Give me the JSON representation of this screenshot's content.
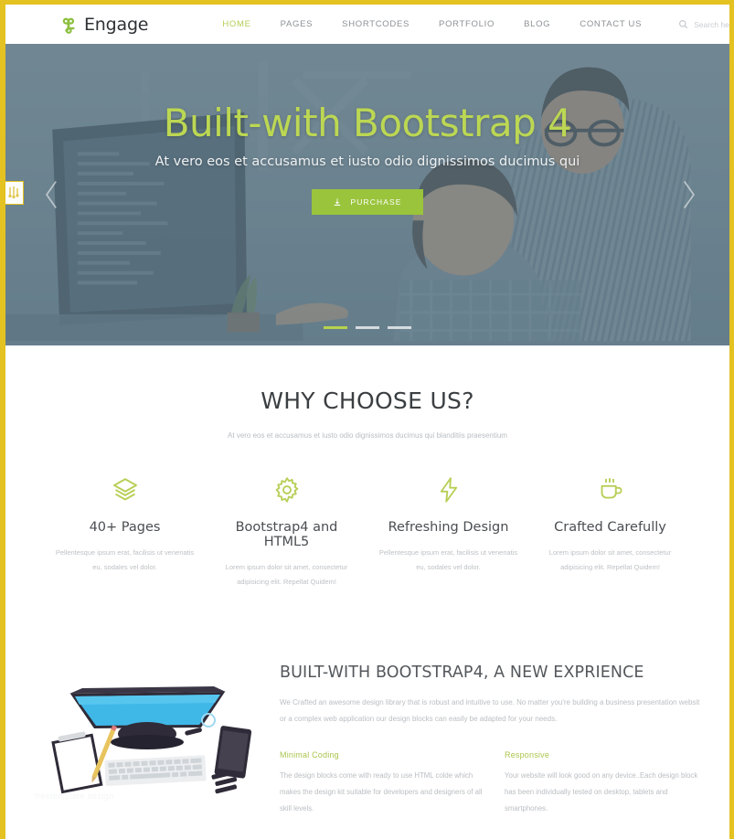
{
  "brand": {
    "name": "Engage",
    "logo_icon": "command-logo-icon",
    "accent_green": "#9ac43c",
    "accent_lime": "#bcd753",
    "border_yellow": "#e3c222"
  },
  "header": {
    "nav": [
      {
        "label": "HOME",
        "active": true
      },
      {
        "label": "PAGES",
        "active": false
      },
      {
        "label": "SHORTCODES",
        "active": false
      },
      {
        "label": "PORTFOLIO",
        "active": false
      },
      {
        "label": "BLOG",
        "active": false
      },
      {
        "label": "CONTACT US",
        "active": false
      }
    ],
    "search": {
      "icon": "search-icon",
      "placeholder": "Search here...",
      "value": ""
    }
  },
  "hero": {
    "title": "Built-with Bootstrap 4",
    "subtitle": "At vero eos et accusamus et iusto odio dignissimos ducimus qui",
    "button": {
      "label": "PURCHASE",
      "icon": "download-icon"
    },
    "prev_icon": "chevron-left-icon",
    "next_icon": "chevron-right-icon",
    "slides": 3,
    "active_slide": 1,
    "side_badge_icon": "tooltip-badge-icon"
  },
  "why": {
    "title": "WHY CHOOSE US?",
    "subtitle": "At vero eos et accusamus et iusto odio dignissimos ducimus qui blanditiis praesentium",
    "features": [
      {
        "icon": "layers-icon",
        "title": "40+ Pages",
        "text": "Pellentesque ipsum erat, facilisis ut venenatis eu, sodales vel dolor."
      },
      {
        "icon": "gear-icon",
        "title": "Bootstrap4 and HTML5",
        "text": "Lorem ipsum dolor sit amet, consectetur adipisicing elit. Repellat Quidem!"
      },
      {
        "icon": "bolt-icon",
        "title": "Refreshing Design",
        "text": "Pellentesque ipsum erat, facilisis ut venenatis eu, sodales vel dolor."
      },
      {
        "icon": "coffee-cup-icon",
        "title": "Crafted Carefully",
        "text": "Lorem ipsum dolor sit amet, consectetur adipisicing elit. Repellat Quidem!"
      }
    ]
  },
  "about": {
    "illustration": "desk-workspace-illustration",
    "watermark": "freetemplate.design",
    "title": "BUILT-WITH BOOTSTRAP4, A NEW EXPRIENCE",
    "text": "We Crafted an awesome design library that is robust and intuitive to use. No matter you're building a business presentation websit or a complex web application our design blocks can easily be adapted for your needs.",
    "columns": [
      {
        "title": "Minimal Coding",
        "text": "The design blocks come with ready to use HTML colde which makes the design kit suitable for developers and designers of all skill levels."
      },
      {
        "title": "Responsive",
        "text": "Your website will look good on any device..Each design block has been individually tested on desktop, tablets and smartphones."
      }
    ]
  }
}
